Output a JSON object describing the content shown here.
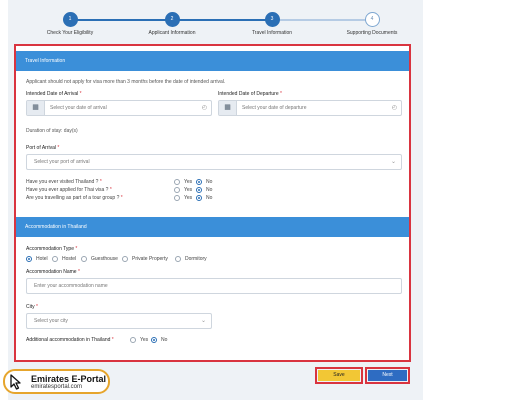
{
  "stepper": {
    "steps": [
      {
        "num": "1",
        "label": "Check Your Eligibility"
      },
      {
        "num": "2",
        "label": "Applicant Information"
      },
      {
        "num": "3",
        "label": "Travel Information"
      },
      {
        "num": "4",
        "label": "Supporting Documents"
      }
    ]
  },
  "travel": {
    "title": "Travel Information",
    "note": "Applicant should not apply for visa more than 3 months before the date of intended arrival.",
    "arrival_label": "Intended Date of Arrival",
    "arrival_placeholder": "Select your date of arrival",
    "departure_label": "Intended Date of Departure",
    "departure_placeholder": "Select your date of departure",
    "duration": "Duration of stay: day(s)",
    "port_label": "Port of Arrival",
    "port_placeholder": "Select your port of arrival",
    "questions": [
      {
        "text": "Have you ever visited Thailand ?",
        "selected": "No"
      },
      {
        "text": "Have you ever applied for Thai visa ?",
        "selected": "No"
      },
      {
        "text": "Are you travelling as part of a tour group ?",
        "selected": "No"
      }
    ],
    "yes_label": "Yes",
    "no_label": "No"
  },
  "accommodation": {
    "title": "Accommodation in Thailand",
    "type_label": "Accommodation Type",
    "types": [
      "Hotel",
      "Hostel",
      "Guesthouse",
      "Private Property",
      "Dormitory"
    ],
    "selected_type": "Hotel",
    "name_label": "Accommodation Name",
    "name_placeholder": "Enter your accommodation name",
    "city_label": "City",
    "city_placeholder": "Select your city",
    "additional_label": "Additional accommodation in Thailand",
    "additional_yes": "Yes",
    "additional_no": "No",
    "additional_selected": "No"
  },
  "actions": {
    "save_label": "Save",
    "next_label": "Next"
  },
  "watermark": {
    "title": "Emirates E-Portal",
    "url": "emiratesportal.com"
  },
  "colors": {
    "primary": "#2b6fb5",
    "section_header": "#3b8fd9",
    "highlight_border": "#d9343f",
    "save_button": "#f2c735",
    "next_button": "#2e6cc2"
  },
  "icons": {
    "date": "calendar-icon",
    "clock": "clock-icon",
    "dropdown": "chevron-down-icon",
    "brand": "cursor-icon"
  }
}
